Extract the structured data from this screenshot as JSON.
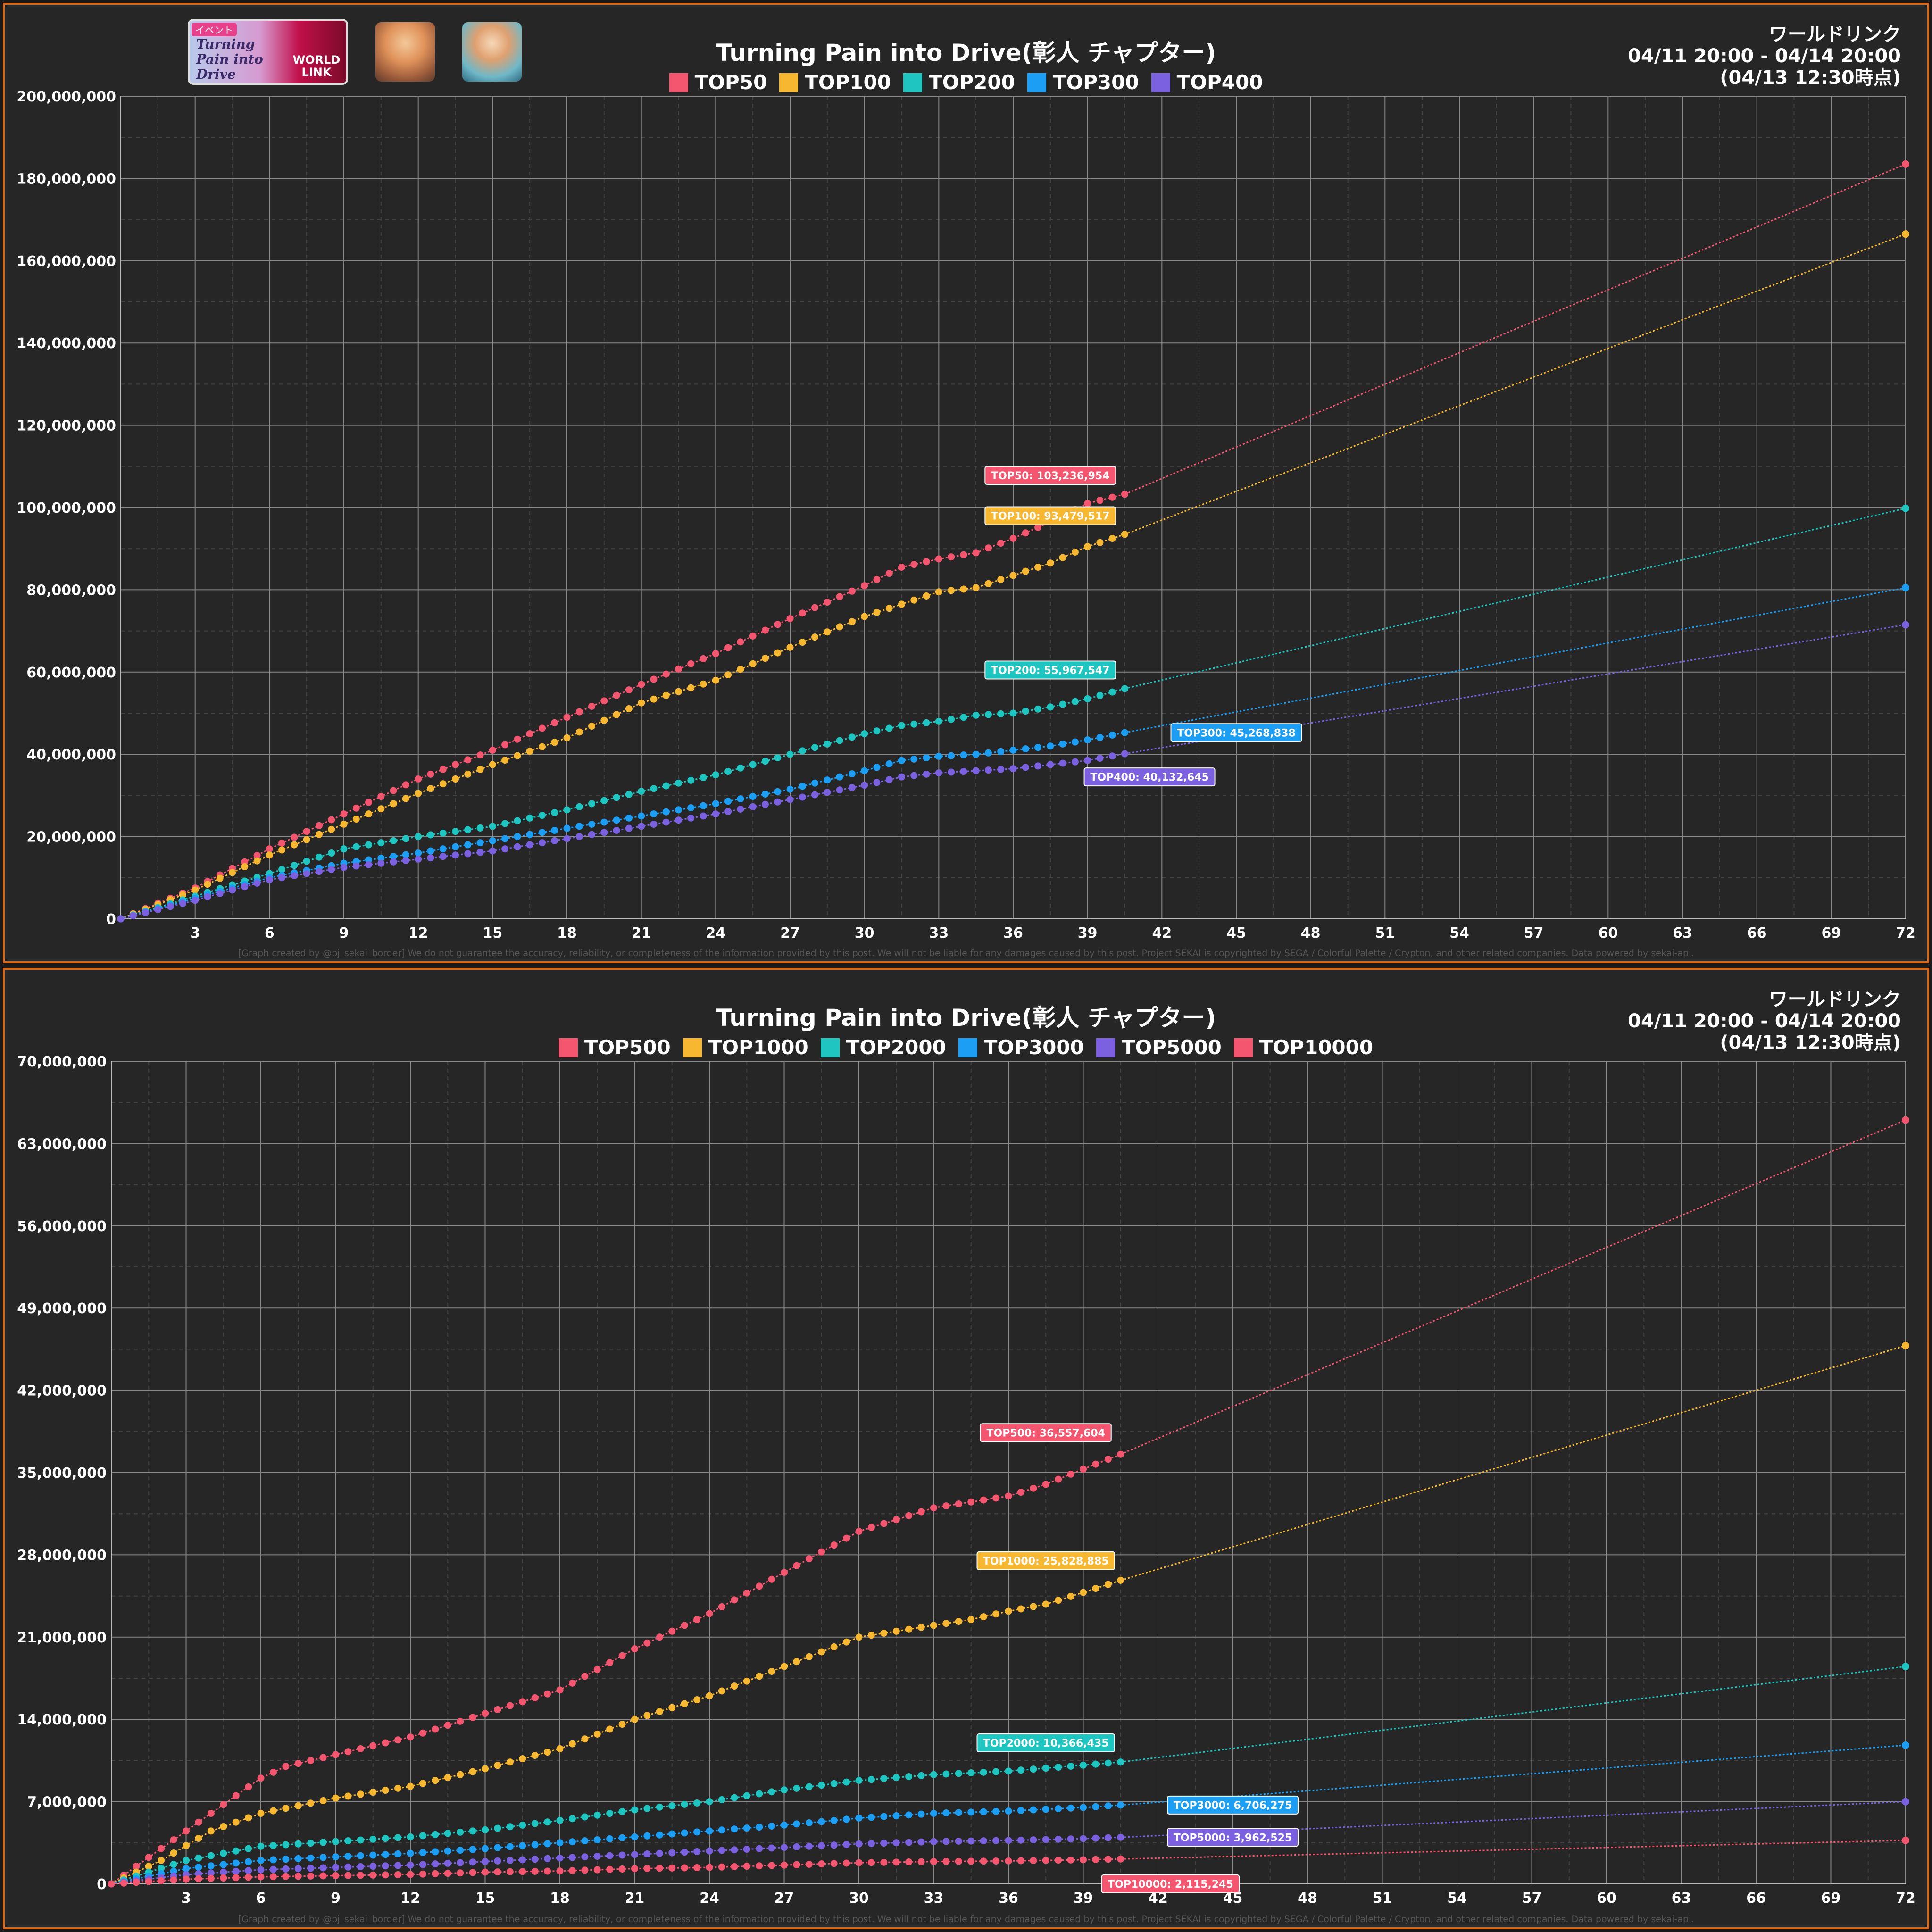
{
  "event": {
    "banner_tag": "イベント",
    "banner_title": "Turning Pain into Drive",
    "banner_sub": "WORLD LINK",
    "thumbnail_1": "character-thumbnail-akito",
    "thumbnail_2": "character-thumbnail-2"
  },
  "footer_text": "[Graph created by @pj_sekai_border]  We do not guarantee the accuracy, reliability, or completeness of the information provided by this post. We will not be liable for any damages caused by this post. Project SEKAI is copyrighted by SEGA / Colorful Palette / Crypton, and other related companies. Data powered by sekai-api.",
  "chart_data": [
    {
      "type": "line",
      "title": "Turning Pain into Drive(彰人 チャプター)",
      "info_lines": [
        "ワールドリンク",
        "04/11 20:00 - 04/14 20:00",
        "(04/13 12:30時点)"
      ],
      "x_ticks": [
        3,
        6,
        9,
        12,
        15,
        18,
        21,
        24,
        27,
        30,
        33,
        36,
        39,
        42,
        45,
        48,
        51,
        54,
        57,
        60,
        63,
        66,
        69,
        72
      ],
      "xlim": [
        0,
        72
      ],
      "ylim": [
        0,
        200000000
      ],
      "y_ticks": [
        "0",
        "20,000,000",
        "40,000,000",
        "60,000,000",
        "80,000,000",
        "100,000,000",
        "120,000,000",
        "140,000,000",
        "160,000,000",
        "180,000,000",
        "200,000,000"
      ],
      "grid": true,
      "legend_position": "top-center",
      "current_hour": 40.5,
      "series": [
        {
          "name": "TOP50",
          "color": "#f4566f",
          "points": [
            [
              0,
              0
            ],
            [
              3,
              7500000
            ],
            [
              6,
              17000000
            ],
            [
              9,
              25500000
            ],
            [
              12,
              34000000
            ],
            [
              15,
              41000000
            ],
            [
              18,
              49000000
            ],
            [
              21,
              57000000
            ],
            [
              24,
              64500000
            ],
            [
              27,
              73000000
            ],
            [
              30,
              81000000
            ],
            [
              31.5,
              85500000
            ],
            [
              33,
              87500000
            ],
            [
              34.5,
              89000000
            ],
            [
              36,
              92500000
            ],
            [
              37.5,
              96500000
            ],
            [
              39,
              101000000
            ],
            [
              40.5,
              103236954
            ]
          ],
          "projection": 183500000,
          "label": "TOP50: 103,236,954"
        },
        {
          "name": "TOP100",
          "color": "#f8b730",
          "points": [
            [
              0,
              0
            ],
            [
              3,
              7000000
            ],
            [
              6,
              15500000
            ],
            [
              9,
              23000000
            ],
            [
              12,
              30500000
            ],
            [
              15,
              37500000
            ],
            [
              18,
              44000000
            ],
            [
              21,
              52500000
            ],
            [
              24,
              58000000
            ],
            [
              27,
              66000000
            ],
            [
              30,
              73500000
            ],
            [
              33,
              79500000
            ],
            [
              34.5,
              80500000
            ],
            [
              36,
              83500000
            ],
            [
              37.5,
              86500000
            ],
            [
              39,
              90500000
            ],
            [
              40.5,
              93479517
            ]
          ],
          "projection": 166500000,
          "label": "TOP100: 93,479,517"
        },
        {
          "name": "TOP200",
          "color": "#1ec5c1",
          "points": [
            [
              0,
              0
            ],
            [
              3,
              5500000
            ],
            [
              6,
              11000000
            ],
            [
              9,
              17000000
            ],
            [
              12,
              20000000
            ],
            [
              15,
              22500000
            ],
            [
              18,
              26500000
            ],
            [
              21,
              31000000
            ],
            [
              24,
              35000000
            ],
            [
              27,
              40000000
            ],
            [
              30,
              45000000
            ],
            [
              31.5,
              47000000
            ],
            [
              33,
              48000000
            ],
            [
              34.5,
              49500000
            ],
            [
              36,
              50000000
            ],
            [
              37.5,
              51500000
            ],
            [
              39,
              53500000
            ],
            [
              40.5,
              55967547
            ]
          ],
          "projection": 99800000,
          "label": "TOP200: 55,967,547"
        },
        {
          "name": "TOP300",
          "color": "#1c9ef5",
          "points": [
            [
              0,
              0
            ],
            [
              3,
              5000000
            ],
            [
              6,
              10000000
            ],
            [
              9,
              13500000
            ],
            [
              12,
              16000000
            ],
            [
              15,
              19000000
            ],
            [
              18,
              22000000
            ],
            [
              21,
              25000000
            ],
            [
              24,
              28000000
            ],
            [
              27,
              31500000
            ],
            [
              30,
              36000000
            ],
            [
              31.5,
              38500000
            ],
            [
              33,
              39500000
            ],
            [
              34.5,
              40000000
            ],
            [
              36,
              41000000
            ],
            [
              37.5,
              42000000
            ],
            [
              39,
              43500000
            ],
            [
              40.5,
              45268838
            ]
          ],
          "projection": 80500000,
          "label": "TOP300: 45,268,838"
        },
        {
          "name": "TOP400",
          "color": "#7b61e0",
          "points": [
            [
              0,
              0
            ],
            [
              3,
              4500000
            ],
            [
              6,
              9500000
            ],
            [
              9,
              12500000
            ],
            [
              12,
              14500000
            ],
            [
              15,
              16500000
            ],
            [
              18,
              19500000
            ],
            [
              21,
              22500000
            ],
            [
              24,
              25500000
            ],
            [
              27,
              29000000
            ],
            [
              30,
              32500000
            ],
            [
              31.5,
              34500000
            ],
            [
              33,
              35500000
            ],
            [
              34.5,
              36000000
            ],
            [
              36,
              36500000
            ],
            [
              37.5,
              37500000
            ],
            [
              39,
              38500000
            ],
            [
              40.5,
              40132645
            ]
          ],
          "projection": 71500000,
          "label": "TOP400: 40,132,645"
        }
      ]
    },
    {
      "type": "line",
      "title": "Turning Pain into Drive(彰人 チャプター)",
      "info_lines": [
        "ワールドリンク",
        "04/11 20:00 - 04/14 20:00",
        "(04/13 12:30時点)"
      ],
      "x_ticks": [
        3,
        6,
        9,
        12,
        15,
        18,
        21,
        24,
        27,
        30,
        33,
        36,
        39,
        42,
        45,
        48,
        51,
        54,
        57,
        60,
        63,
        66,
        69,
        72
      ],
      "xlim": [
        0,
        72
      ],
      "ylim": [
        0,
        70000000
      ],
      "y_ticks": [
        "0",
        "7,000,000",
        "14,000,000",
        "21,000,000",
        "28,000,000",
        "35,000,000",
        "42,000,000",
        "49,000,000",
        "56,000,000",
        "63,000,000",
        "70,000,000"
      ],
      "grid": true,
      "legend_position": "top-center",
      "current_hour": 40.5,
      "series": [
        {
          "name": "TOP500",
          "color": "#f4566f",
          "points": [
            [
              0,
              0
            ],
            [
              1,
              1500000
            ],
            [
              3,
              4500000
            ],
            [
              5,
              7500000
            ],
            [
              6,
              9000000
            ],
            [
              7,
              10000000
            ],
            [
              9,
              11000000
            ],
            [
              12,
              12500000
            ],
            [
              15,
              14500000
            ],
            [
              18,
              16500000
            ],
            [
              21,
              20000000
            ],
            [
              24,
              23000000
            ],
            [
              27,
              26500000
            ],
            [
              30,
              30000000
            ],
            [
              31.5,
              31000000
            ],
            [
              33,
              32000000
            ],
            [
              34.5,
              32500000
            ],
            [
              36,
              33000000
            ],
            [
              37.5,
              34000000
            ],
            [
              39,
              35300000
            ],
            [
              40.5,
              36557604
            ]
          ],
          "projection": 65000000,
          "label": "TOP500: 36,557,604"
        },
        {
          "name": "TOP1000",
          "color": "#f8b730",
          "points": [
            [
              0,
              0
            ],
            [
              2,
              2000000
            ],
            [
              4,
              4500000
            ],
            [
              6,
              6000000
            ],
            [
              9,
              7300000
            ],
            [
              12,
              8300000
            ],
            [
              15,
              9800000
            ],
            [
              18,
              11500000
            ],
            [
              21,
              14000000
            ],
            [
              24,
              16000000
            ],
            [
              27,
              18500000
            ],
            [
              30,
              21000000
            ],
            [
              31.5,
              21500000
            ],
            [
              33,
              22000000
            ],
            [
              34.5,
              22500000
            ],
            [
              36,
              23200000
            ],
            [
              37.5,
              23800000
            ],
            [
              39,
              24800000
            ],
            [
              40.5,
              25828885
            ]
          ],
          "projection": 45800000,
          "label": "TOP1000: 25,828,885"
        },
        {
          "name": "TOP2000",
          "color": "#1ec5c1",
          "points": [
            [
              0,
              0
            ],
            [
              3,
              2000000
            ],
            [
              6,
              3200000
            ],
            [
              9,
              3600000
            ],
            [
              12,
              4000000
            ],
            [
              15,
              4600000
            ],
            [
              18,
              5400000
            ],
            [
              21,
              6300000
            ],
            [
              24,
              7000000
            ],
            [
              27,
              8000000
            ],
            [
              30,
              8800000
            ],
            [
              33,
              9300000
            ],
            [
              36,
              9600000
            ],
            [
              39,
              10100000
            ],
            [
              40.5,
              10366435
            ]
          ],
          "projection": 18500000,
          "label": "TOP2000: 10,366,435"
        },
        {
          "name": "TOP3000",
          "color": "#1c9ef5",
          "points": [
            [
              0,
              0
            ],
            [
              3,
              1300000
            ],
            [
              6,
              2000000
            ],
            [
              9,
              2300000
            ],
            [
              12,
              2600000
            ],
            [
              15,
              3000000
            ],
            [
              18,
              3500000
            ],
            [
              21,
              4000000
            ],
            [
              24,
              4500000
            ],
            [
              27,
              5000000
            ],
            [
              30,
              5600000
            ],
            [
              33,
              6000000
            ],
            [
              36,
              6200000
            ],
            [
              39,
              6500000
            ],
            [
              40.5,
              6706275
            ]
          ],
          "projection": 11800000,
          "label": "TOP3000: 6,706,275"
        },
        {
          "name": "TOP5000",
          "color": "#7b61e0",
          "points": [
            [
              0,
              0
            ],
            [
              3,
              800000
            ],
            [
              6,
              1200000
            ],
            [
              9,
              1400000
            ],
            [
              12,
              1600000
            ],
            [
              15,
              1900000
            ],
            [
              18,
              2200000
            ],
            [
              21,
              2500000
            ],
            [
              24,
              2800000
            ],
            [
              27,
              3100000
            ],
            [
              30,
              3400000
            ],
            [
              33,
              3600000
            ],
            [
              36,
              3700000
            ],
            [
              39,
              3850000
            ],
            [
              40.5,
              3962525
            ]
          ],
          "projection": 7000000,
          "label": "TOP5000: 3,962,525"
        },
        {
          "name": "TOP10000",
          "color": "#f4566f",
          "points": [
            [
              0,
              0
            ],
            [
              3,
              400000
            ],
            [
              6,
              600000
            ],
            [
              9,
              700000
            ],
            [
              12,
              800000
            ],
            [
              15,
              1000000
            ],
            [
              18,
              1100000
            ],
            [
              21,
              1300000
            ],
            [
              24,
              1400000
            ],
            [
              27,
              1600000
            ],
            [
              30,
              1800000
            ],
            [
              33,
              1900000
            ],
            [
              36,
              1950000
            ],
            [
              39,
              2050000
            ],
            [
              40.5,
              2115245
            ]
          ],
          "projection": 3700000,
          "label": "TOP10000: 2,115,245"
        }
      ]
    }
  ]
}
